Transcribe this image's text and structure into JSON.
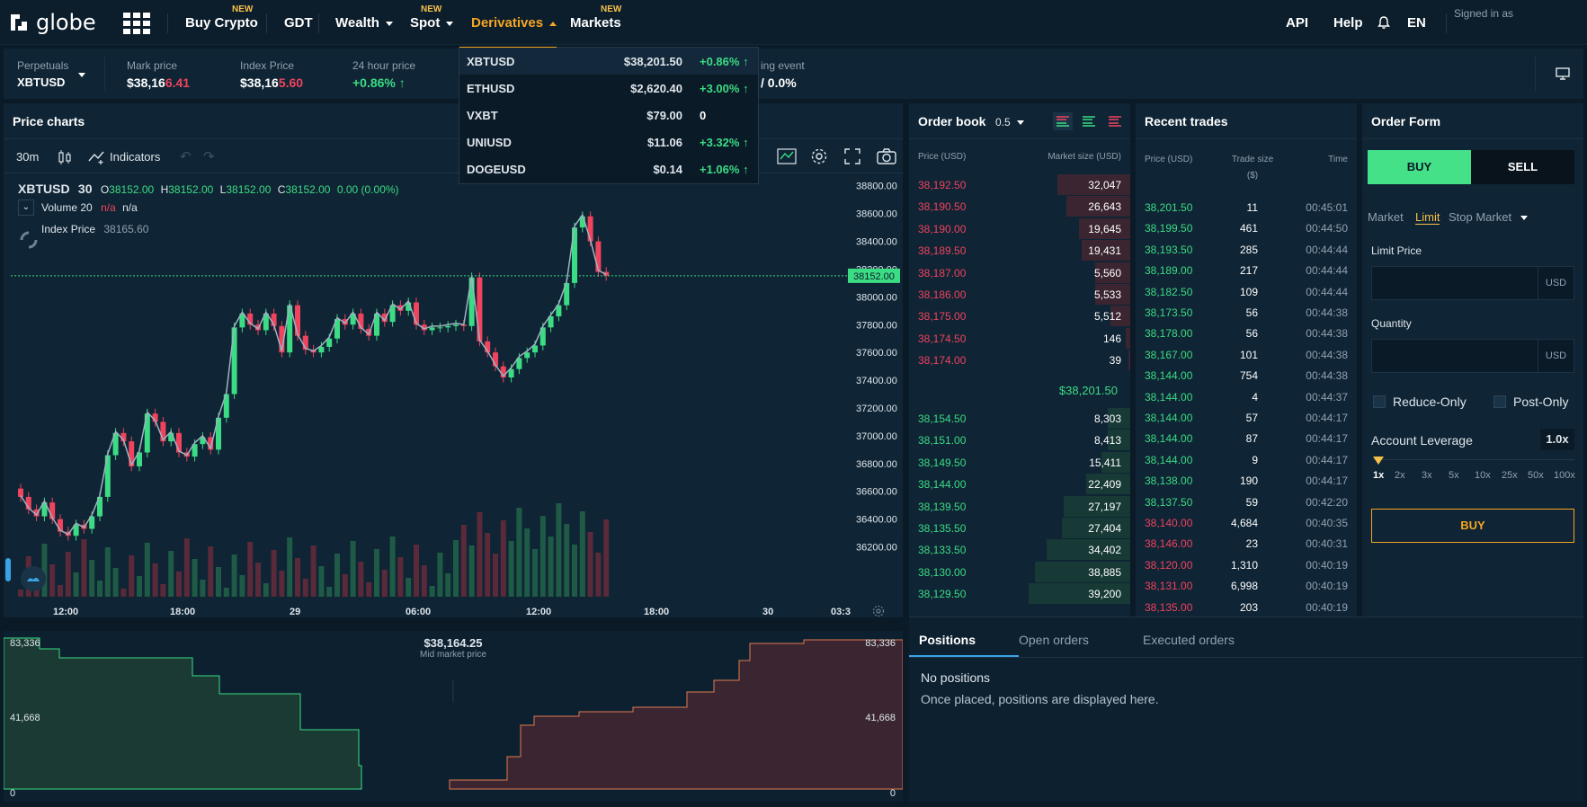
{
  "nav": {
    "logo": "globe",
    "items": [
      {
        "label": "Buy Crypto",
        "badge": "NEW"
      },
      {
        "label": "GDT"
      },
      {
        "label": "Wealth"
      },
      {
        "label": "Spot",
        "badge": "NEW"
      },
      {
        "label": "Derivatives"
      },
      {
        "label": "Markets",
        "badge": "NEW"
      }
    ],
    "right": {
      "api": "API",
      "help": "Help",
      "lang": "EN",
      "signed": "Signed in as"
    }
  },
  "ticker": {
    "market_label": "Perpetuals",
    "market_value": "XBTUSD",
    "mark_label": "Mark price",
    "mark_prefix": "$38,16",
    "mark_suffix": "6.41",
    "index_label": "Index Price",
    "index_prefix": "$38,16",
    "index_suffix": "5.60",
    "change_label": "24 hour price",
    "change_value": "+0.86% ↑",
    "funding_label": "ing event",
    "funding_value": "/ 0.0%"
  },
  "dropdown": [
    {
      "symbol": "XBTUSD",
      "price": "$38,201.50",
      "change": "+0.86% ↑"
    },
    {
      "symbol": "ETHUSD",
      "price": "$2,620.40",
      "change": "+3.00% ↑"
    },
    {
      "symbol": "VXBT",
      "price": "$79.00",
      "change": "0"
    },
    {
      "symbol": "UNIUSD",
      "price": "$11.06",
      "change": "+3.32% ↑"
    },
    {
      "symbol": "DOGEUSD",
      "price": "$0.14",
      "change": "+1.06% ↑"
    }
  ],
  "price_chart": {
    "title": "Price charts",
    "interval": "30m",
    "indicators": "Indicators",
    "symbol": "XBTUSD",
    "symbol_tf": "30",
    "ohlc": {
      "o_label": "O",
      "o": "38152.00",
      "h_label": "H",
      "h": "38152.00",
      "l_label": "L",
      "l": "38152.00",
      "c_label": "C",
      "c": "38152.00",
      "chg": "0.00 (0.00%)"
    },
    "volume_label": "Volume 20",
    "volume_val1": "n/a",
    "volume_val2": "n/a",
    "index_label": "Index Price",
    "index_val": "38165.60",
    "last_price_tag": "38152.00"
  },
  "chart_data": {
    "type": "candlestick",
    "y_ticks": [
      "38800.00",
      "38600.00",
      "38400.00",
      "38200.00",
      "38000.00",
      "37800.00",
      "37600.00",
      "37400.00",
      "37200.00",
      "37000.00",
      "36800.00",
      "36600.00",
      "36400.00",
      "36200.00"
    ],
    "x_ticks": [
      "12:00",
      "18:00",
      "29",
      "06:00",
      "12:00",
      "18:00",
      "30",
      "03:3"
    ],
    "ylim": [
      36100,
      38850
    ],
    "last_price": 38152
  },
  "depth": {
    "mid_price": "$38,164.25",
    "mid_label": "Mid market price",
    "left_top": "83,336",
    "left_mid": "41,668",
    "left_zero": "0",
    "right_top": "83,336",
    "right_mid": "41,668",
    "right_zero": "0"
  },
  "orderbook": {
    "title": "Order book",
    "step": "0.5",
    "col_price": "Price (USD)",
    "col_size": "Market size (USD)",
    "asks": [
      {
        "price": "38,192.50",
        "size": "32,047",
        "depth": 0.33
      },
      {
        "price": "38,190.50",
        "size": "26,643",
        "depth": 0.29
      },
      {
        "price": "38,190.00",
        "size": "19,645",
        "depth": 0.23
      },
      {
        "price": "38,189.50",
        "size": "19,431",
        "depth": 0.22
      },
      {
        "price": "38,187.00",
        "size": "5,560",
        "depth": 0.16
      },
      {
        "price": "38,186.00",
        "size": "5,533",
        "depth": 0.16
      },
      {
        "price": "38,175.00",
        "size": "5,512",
        "depth": 0.09
      },
      {
        "price": "38,174.50",
        "size": "146",
        "depth": 0.02
      },
      {
        "price": "38,174.00",
        "size": "39",
        "depth": 0.01
      }
    ],
    "last": "$38,201.50",
    "bids": [
      {
        "price": "38,154.50",
        "size": "8,303",
        "depth": 0.1
      },
      {
        "price": "38,151.00",
        "size": "8,413",
        "depth": 0.1
      },
      {
        "price": "38,149.50",
        "size": "15,411",
        "depth": 0.13
      },
      {
        "price": "38,144.00",
        "size": "22,409",
        "depth": 0.2
      },
      {
        "price": "38,139.50",
        "size": "27,197",
        "depth": 0.3
      },
      {
        "price": "38,135.50",
        "size": "27,404",
        "depth": 0.31
      },
      {
        "price": "38,133.50",
        "size": "34,402",
        "depth": 0.38
      },
      {
        "price": "38,130.00",
        "size": "38,885",
        "depth": 0.43
      },
      {
        "price": "38,129.50",
        "size": "39,200",
        "depth": 0.46
      }
    ]
  },
  "trades": {
    "title": "Recent trades",
    "col_price": "Price (USD)",
    "col_size": "Trade size",
    "col_size_unit": "($)",
    "col_time": "Time",
    "rows": [
      {
        "price": "38,201.50",
        "size": "11",
        "time": "00:45:01",
        "side": "buy"
      },
      {
        "price": "38,199.50",
        "size": "461",
        "time": "00:44:50",
        "side": "buy"
      },
      {
        "price": "38,193.50",
        "size": "285",
        "time": "00:44:44",
        "side": "buy"
      },
      {
        "price": "38,189.00",
        "size": "217",
        "time": "00:44:44",
        "side": "buy"
      },
      {
        "price": "38,182.50",
        "size": "109",
        "time": "00:44:44",
        "side": "buy"
      },
      {
        "price": "38,173.50",
        "size": "56",
        "time": "00:44:38",
        "side": "buy"
      },
      {
        "price": "38,178.00",
        "size": "56",
        "time": "00:44:38",
        "side": "buy"
      },
      {
        "price": "38,167.00",
        "size": "101",
        "time": "00:44:38",
        "side": "buy"
      },
      {
        "price": "38,144.00",
        "size": "754",
        "time": "00:44:38",
        "side": "buy"
      },
      {
        "price": "38,144.00",
        "size": "4",
        "time": "00:44:37",
        "side": "buy"
      },
      {
        "price": "38,144.00",
        "size": "57",
        "time": "00:44:17",
        "side": "buy"
      },
      {
        "price": "38,144.00",
        "size": "87",
        "time": "00:44:17",
        "side": "buy"
      },
      {
        "price": "38,144.00",
        "size": "9",
        "time": "00:44:17",
        "side": "buy"
      },
      {
        "price": "38,138.00",
        "size": "190",
        "time": "00:44:17",
        "side": "buy"
      },
      {
        "price": "38,137.50",
        "size": "59",
        "time": "00:42:20",
        "side": "buy"
      },
      {
        "price": "38,140.00",
        "size": "4,684",
        "time": "00:40:35",
        "side": "sell"
      },
      {
        "price": "38,146.00",
        "size": "23",
        "time": "00:40:31",
        "side": "sell"
      },
      {
        "price": "38,120.00",
        "size": "1,310",
        "time": "00:40:19",
        "side": "sell"
      },
      {
        "price": "38,131.00",
        "size": "6,998",
        "time": "00:40:19",
        "side": "sell"
      },
      {
        "price": "38,135.00",
        "size": "203",
        "time": "00:40:19",
        "side": "sell"
      }
    ]
  },
  "order_form": {
    "title": "Order Form",
    "buy": "BUY",
    "sell": "SELL",
    "types": [
      "Market",
      "Limit",
      "Stop Market"
    ],
    "limit_price_label": "Limit Price",
    "limit_unit": "USD",
    "quantity_label": "Quantity",
    "quantity_unit": "USD",
    "reduce_only": "Reduce-Only",
    "post_only": "Post-Only",
    "leverage_label": "Account Leverage",
    "leverage_value": "1.0x",
    "leverage_ticks": [
      "1x",
      "2x",
      "3x",
      "5x",
      "10x",
      "25x",
      "50x",
      "100x"
    ],
    "submit": "BUY"
  },
  "positions": {
    "tabs": [
      "Positions",
      "Open orders",
      "Executed orders"
    ],
    "empty_title": "No positions",
    "empty_text": "Once placed, positions are displayed here."
  }
}
